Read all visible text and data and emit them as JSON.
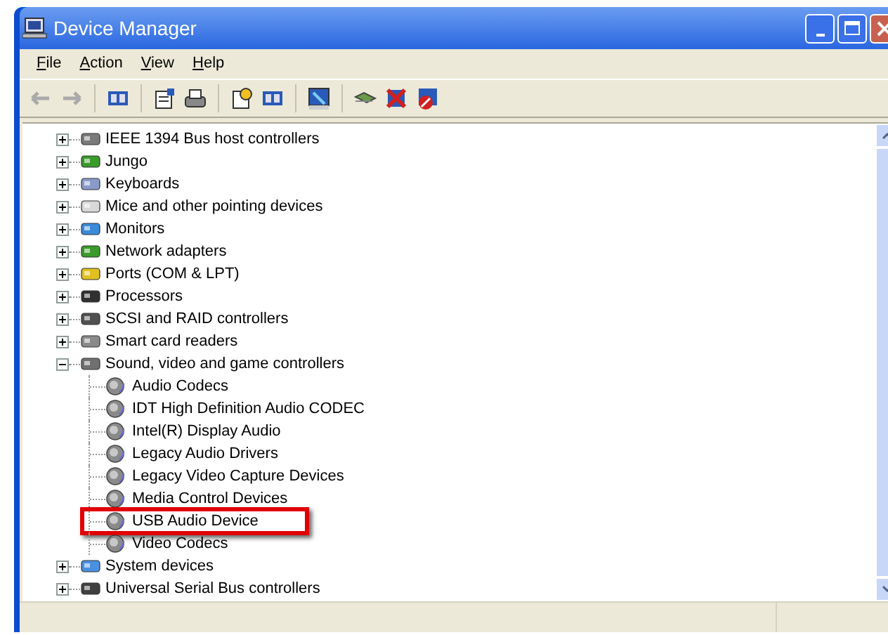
{
  "window": {
    "title": "Device Manager"
  },
  "menu": [
    "File",
    "Action",
    "View",
    "Help"
  ],
  "tree": [
    {
      "label": "IEEE 1394 Bus host controllers",
      "expanded": false
    },
    {
      "label": "Jungo",
      "expanded": false
    },
    {
      "label": "Keyboards",
      "expanded": false
    },
    {
      "label": "Mice and other pointing devices",
      "expanded": false
    },
    {
      "label": "Monitors",
      "expanded": false
    },
    {
      "label": "Network adapters",
      "expanded": false
    },
    {
      "label": "Ports (COM & LPT)",
      "expanded": false
    },
    {
      "label": "Processors",
      "expanded": false
    },
    {
      "label": "SCSI and RAID controllers",
      "expanded": false
    },
    {
      "label": "Smart card readers",
      "expanded": false
    },
    {
      "label": "Sound, video and game controllers",
      "expanded": true,
      "children": [
        {
          "label": "Audio Codecs",
          "highlighted": false
        },
        {
          "label": "IDT High Definition Audio CODEC",
          "highlighted": false
        },
        {
          "label": "Intel(R) Display Audio",
          "highlighted": false
        },
        {
          "label": "Legacy Audio Drivers",
          "highlighted": false
        },
        {
          "label": "Legacy Video Capture Devices",
          "highlighted": false
        },
        {
          "label": "Media Control Devices",
          "highlighted": false
        },
        {
          "label": "USB Audio Device",
          "highlighted": true
        },
        {
          "label": "Video Codecs",
          "highlighted": false
        }
      ]
    },
    {
      "label": "System devices",
      "expanded": false
    },
    {
      "label": "Universal Serial Bus controllers",
      "expanded": false
    }
  ]
}
